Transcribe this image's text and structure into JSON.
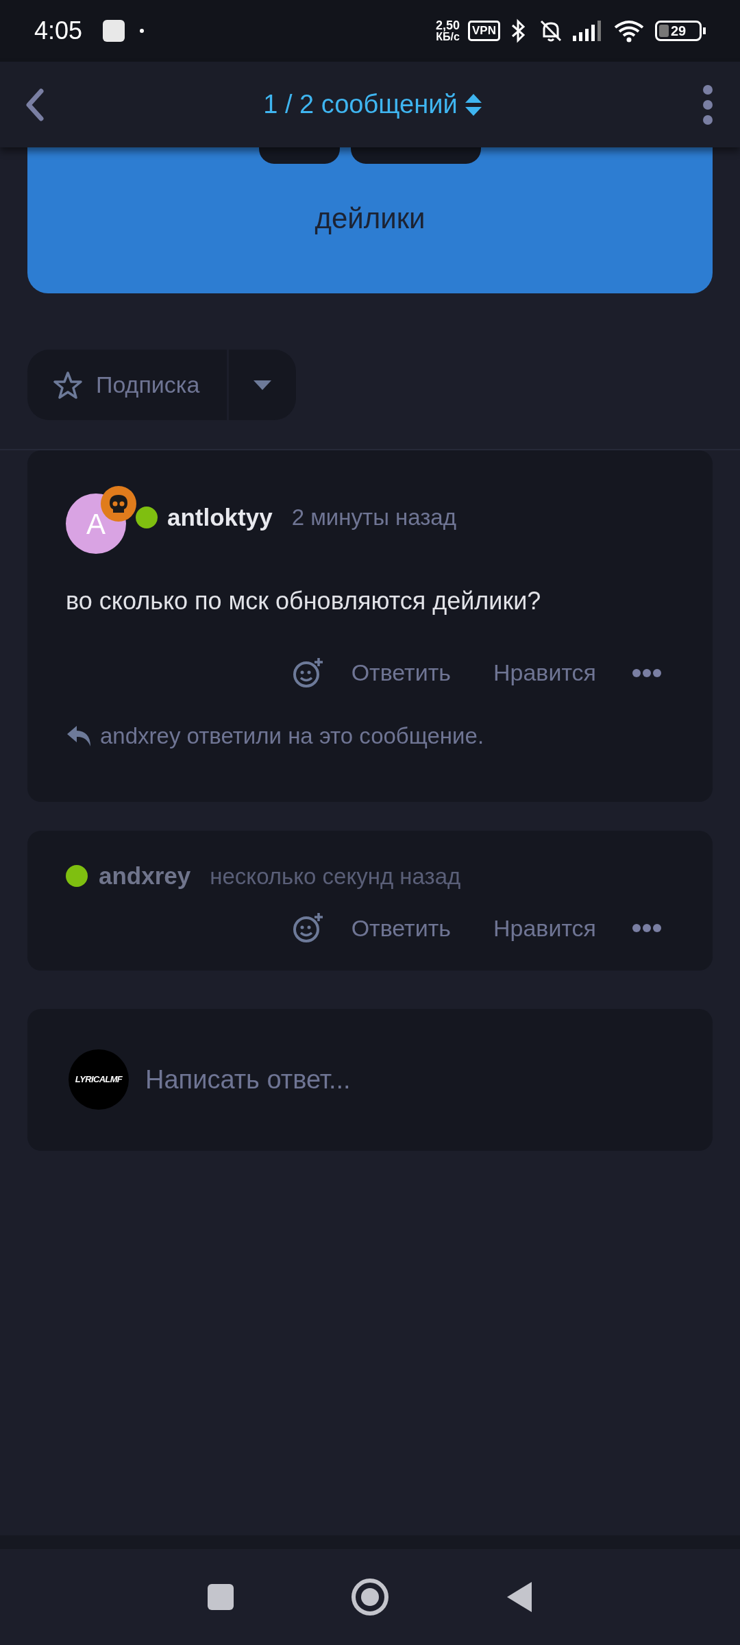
{
  "status_bar": {
    "time": "4:05",
    "speed_value": "2,50",
    "speed_unit": "КБ/с",
    "vpn": "VPN",
    "battery": "29"
  },
  "header": {
    "title": "1 / 2 сообщений"
  },
  "thread_card": {
    "tags": [
      {
        "kind": "tag"
      },
      {
        "kind": "tag"
      }
    ],
    "title": "дейлики"
  },
  "subscribe": {
    "label": "Подписка",
    "on": false
  },
  "posts": [
    {
      "kind": "full",
      "avatar_letter": "A",
      "badge": true,
      "online": true,
      "author": "antloktyy",
      "time": "2 минуты назад",
      "body": "во сколько по мск обновляются дейлики?",
      "actions": {
        "reply": "Ответить",
        "like": "Нравится"
      },
      "reply_note": "andxrey ответили на это сообщение."
    },
    {
      "kind": "collapsed",
      "online": true,
      "author": "andxrey",
      "time": "несколько секунд назад",
      "actions": {
        "reply": "Ответить",
        "like": "Нравится"
      }
    }
  ],
  "composer": {
    "avatar_text": "LYRICALMF",
    "placeholder": "Написать ответ..."
  }
}
